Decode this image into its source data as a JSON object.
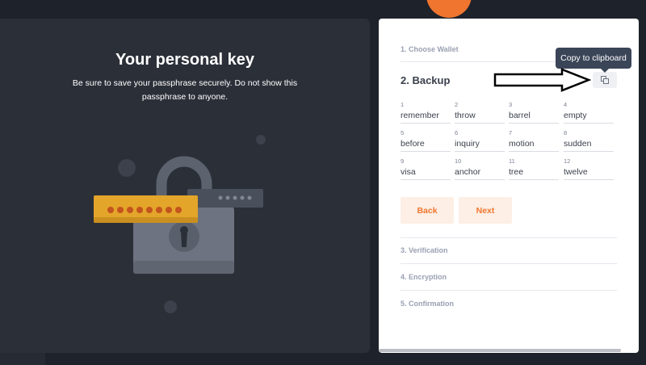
{
  "left": {
    "title": "Your personal key",
    "subtitle": "Be sure to save your passphrase securely. Do not show this passphrase to anyone."
  },
  "steps": {
    "step1": "1. Choose Wallet",
    "step2": "2. Backup",
    "step3": "3. Verification",
    "step4": "4. Encryption",
    "step5": "5. Confirmation"
  },
  "tooltip": "Copy to clipboard",
  "words": [
    {
      "n": "1",
      "w": "remember"
    },
    {
      "n": "2",
      "w": "throw"
    },
    {
      "n": "3",
      "w": "barrel"
    },
    {
      "n": "4",
      "w": "empty"
    },
    {
      "n": "5",
      "w": "before"
    },
    {
      "n": "6",
      "w": "inquiry"
    },
    {
      "n": "7",
      "w": "motion"
    },
    {
      "n": "8",
      "w": "sudden"
    },
    {
      "n": "9",
      "w": "visa"
    },
    {
      "n": "10",
      "w": "anchor"
    },
    {
      "n": "11",
      "w": "tree"
    },
    {
      "n": "12",
      "w": "twelve"
    }
  ],
  "buttons": {
    "back": "Back",
    "next": "Next"
  },
  "colors": {
    "accent": "#f0762f",
    "panel_dark": "#2b2f38",
    "tooltip_bg": "#3b4558",
    "key_yellow": "#e3a52a"
  },
  "icons": {
    "copy": "copy-icon",
    "lock": "padlock-illustration",
    "arrow": "arrow-annotation"
  }
}
